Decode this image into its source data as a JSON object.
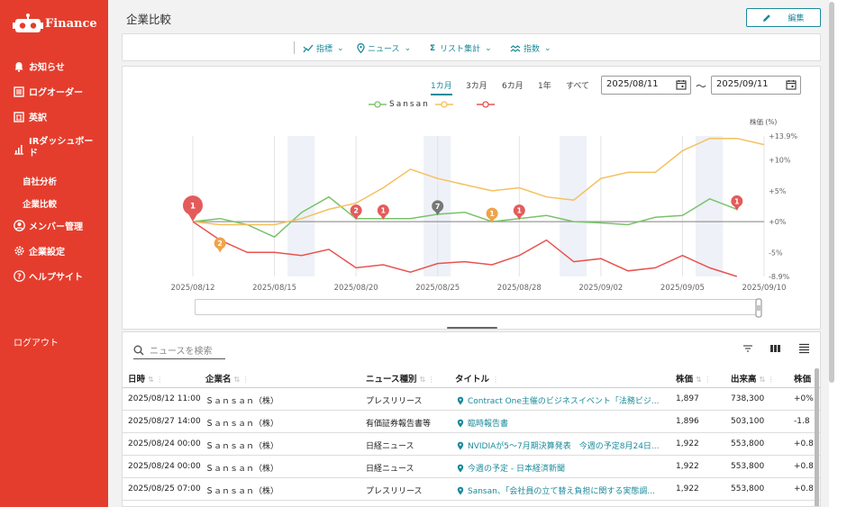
{
  "app": {
    "logo_text": "Finance"
  },
  "sidebar": {
    "items": [
      {
        "label": "お知らせ",
        "icon": "bell-icon"
      },
      {
        "label": "ログオーダー",
        "icon": "list-icon"
      },
      {
        "label": "英訳",
        "icon": "translate-icon"
      },
      {
        "label": "IRダッシュボード",
        "icon": "bar-chart-icon"
      },
      {
        "label": "メンバー管理",
        "icon": "user-circle-icon"
      },
      {
        "label": "企業設定",
        "icon": "gear-icon"
      },
      {
        "label": "ヘルプサイト",
        "icon": "help-icon"
      }
    ],
    "ir_label_line1": "IRダッシュボー",
    "ir_label_line2": "ド",
    "subitems": [
      {
        "label": "自社分析"
      },
      {
        "label": "企業比較"
      }
    ],
    "logout": "ログアウト"
  },
  "header": {
    "title": "企業比較",
    "edit_label": "編集"
  },
  "toolbar": {
    "items": [
      {
        "label": "指標",
        "icon": "trend-icon"
      },
      {
        "label": "ニュース",
        "icon": "pin-icon"
      },
      {
        "label": "リスト集計",
        "icon": "sigma-icon"
      },
      {
        "label": "指数",
        "icon": "wave-icon"
      }
    ]
  },
  "chart_controls": {
    "ranges": [
      "1カ月",
      "3カ月",
      "6カ月",
      "1年",
      "すべて"
    ],
    "active_range": "1カ月",
    "date_from": "2025/08/11",
    "date_to": "2025/09/11",
    "separator": "〜"
  },
  "chart_data": {
    "type": "line",
    "ylabel": "株価 (%)",
    "x": [
      "2025/08/12",
      "2025/08/13",
      "2025/08/14",
      "2025/08/15",
      "2025/08/18",
      "2025/08/19",
      "2025/08/20",
      "2025/08/21",
      "2025/08/22",
      "2025/08/25",
      "2025/08/26",
      "2025/08/27",
      "2025/08/28",
      "2025/08/29",
      "2025/09/01",
      "2025/09/02",
      "2025/09/03",
      "2025/09/04",
      "2025/09/05",
      "2025/09/08",
      "2025/09/09",
      "2025/09/10"
    ],
    "xticks": [
      "2025/08/12",
      "2025/08/15",
      "2025/08/20",
      "2025/08/25",
      "2025/08/28",
      "2025/09/02",
      "2025/09/05",
      "2025/09/10"
    ],
    "yticks": [
      "+13.9%",
      "+10%",
      "+5%",
      "+0%",
      "-5%",
      "-8.9%"
    ],
    "ylim": [
      -8.9,
      13.9
    ],
    "series": [
      {
        "name": "Sansan",
        "color": "#7ac36a",
        "values": [
          0,
          0.5,
          -0.5,
          -2.5,
          1.5,
          4.0,
          0.5,
          0.5,
          0.5,
          1.2,
          1.5,
          0,
          0.5,
          1.0,
          0,
          -0.2,
          -0.5,
          0.7,
          1.0,
          3.7,
          2.0
        ]
      },
      {
        "name": "",
        "color": "#f4c05e",
        "values": [
          0,
          -0.5,
          -0.5,
          -0.5,
          0.5,
          2.0,
          3.0,
          5.5,
          8.5,
          7.0,
          6.0,
          5.0,
          5.5,
          4.0,
          3.5,
          7.0,
          8.0,
          8.0,
          11.5,
          13.5,
          13.5,
          12.5
        ]
      },
      {
        "name": "",
        "color": "#e8534f",
        "values": [
          0,
          -3.0,
          -5.0,
          -5.0,
          -5.5,
          -4.5,
          -7.5,
          -7.0,
          -8.2,
          -6.8,
          -6.5,
          -7.0,
          -5.5,
          -3.0,
          -6.5,
          -6.0,
          -8.0,
          -7.5,
          -5.5,
          -7.5,
          -8.9
        ]
      }
    ],
    "markers": [
      {
        "label": "1",
        "x_index": 0,
        "color": "#e45b5b"
      },
      {
        "label": "2",
        "x_index": 1,
        "color": "#f0a24b"
      },
      {
        "label": "2",
        "x_index": 6,
        "color": "#e45b5b"
      },
      {
        "label": "1",
        "x_index": 7,
        "color": "#e45b5b"
      },
      {
        "label": "7",
        "x_index": 9,
        "color": "#777"
      },
      {
        "label": "1",
        "x_index": 11,
        "color": "#f0a24b"
      },
      {
        "label": "1",
        "x_index": 12,
        "color": "#e45b5b"
      },
      {
        "label": "1",
        "x_index": 20,
        "color": "#e45b5b"
      }
    ]
  },
  "news": {
    "search_placeholder": "ニュースを検索",
    "columns": [
      "日時",
      "企業名",
      "ニュース種別",
      "タイトル",
      "株価",
      "出来高",
      "株価"
    ],
    "rows": [
      {
        "date": "2025/08/12 11:00",
        "company": "Ｓａｎｓａｎ（株）",
        "type": "プレスリリース",
        "title": "Contract One主催のビジネスイベント「法務ビジ...",
        "price": "1,897",
        "volume": "738,300",
        "change": "+0%"
      },
      {
        "date": "2025/08/27 14:00",
        "company": "Ｓａｎｓａｎ（株）",
        "type": "有価証券報告書等",
        "title": "臨時報告書",
        "price": "1,896",
        "volume": "503,100",
        "change": "-1.8"
      },
      {
        "date": "2025/08/24 00:00",
        "company": "Ｓａｎｓａｎ（株）",
        "type": "日経ニュース",
        "title": "NVIDIAが5～7月期決算発表　今週の予定8月24日...",
        "price": "1,922",
        "volume": "553,800",
        "change": "+0.8"
      },
      {
        "date": "2025/08/24 00:00",
        "company": "Ｓａｎｓａｎ（株）",
        "type": "日経ニュース",
        "title": "今週の予定 - 日本経済新聞",
        "price": "1,922",
        "volume": "553,800",
        "change": "+0.8"
      },
      {
        "date": "2025/08/25 07:00",
        "company": "Ｓａｎｓａｎ（株）",
        "type": "プレスリリース",
        "title": "Sansan、「会社員の立て替え負担に関する実態調...",
        "price": "1,922",
        "volume": "553,800",
        "change": "+0.8"
      }
    ]
  }
}
